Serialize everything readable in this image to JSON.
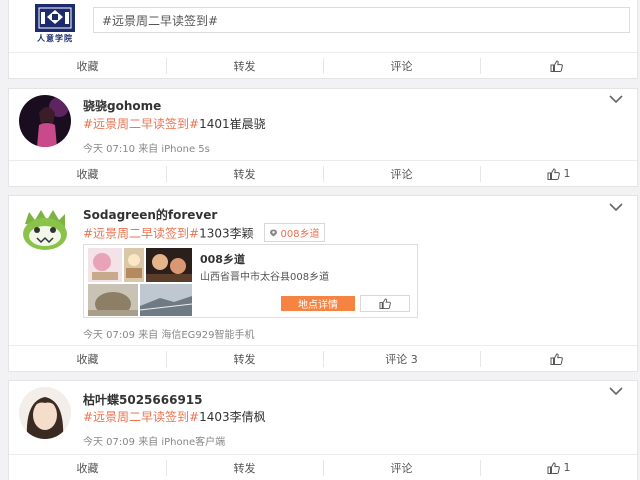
{
  "composer": {
    "logo_text": "人意学院",
    "input_value": "#远景周二早读签到#",
    "actions": {
      "favorite": "收藏",
      "forward": "转发",
      "comment": "评论",
      "like_count": ""
    }
  },
  "posts": [
    {
      "username": "骁骁gohome",
      "topic": "#远景周二早读签到#",
      "content": "1401崔晨骁",
      "time": "今天 07:10",
      "source": "来自 iPhone 5s",
      "actions": {
        "favorite": "收藏",
        "forward": "转发",
        "comment": "评论",
        "like_count": "1"
      }
    },
    {
      "username": "Sodagreen的forever",
      "topic": "#远景周二早读签到#",
      "content": "1303李颖",
      "location_tag": "008乡道",
      "location_card": {
        "name": "008乡道",
        "address": "山西省晋中市太谷县008乡道",
        "details_button": "地点详情"
      },
      "time": "今天 07:09",
      "source": "来自 海信EG929智能手机",
      "actions": {
        "favorite": "收藏",
        "forward": "转发",
        "comment": "评论 3",
        "like_count": ""
      }
    },
    {
      "username": "枯叶蝶5025666915",
      "topic": "#远景周二早读签到#",
      "content": "1403李倩枫",
      "time": "今天 07:09",
      "source": "来自 iPhone客户端",
      "actions": {
        "favorite": "收藏",
        "forward": "转发",
        "comment": "评论",
        "like_count": "1"
      }
    }
  ],
  "colors": {
    "topic": "#eb7350",
    "button": "#f58442",
    "page_bg": "#f2f2f5"
  }
}
